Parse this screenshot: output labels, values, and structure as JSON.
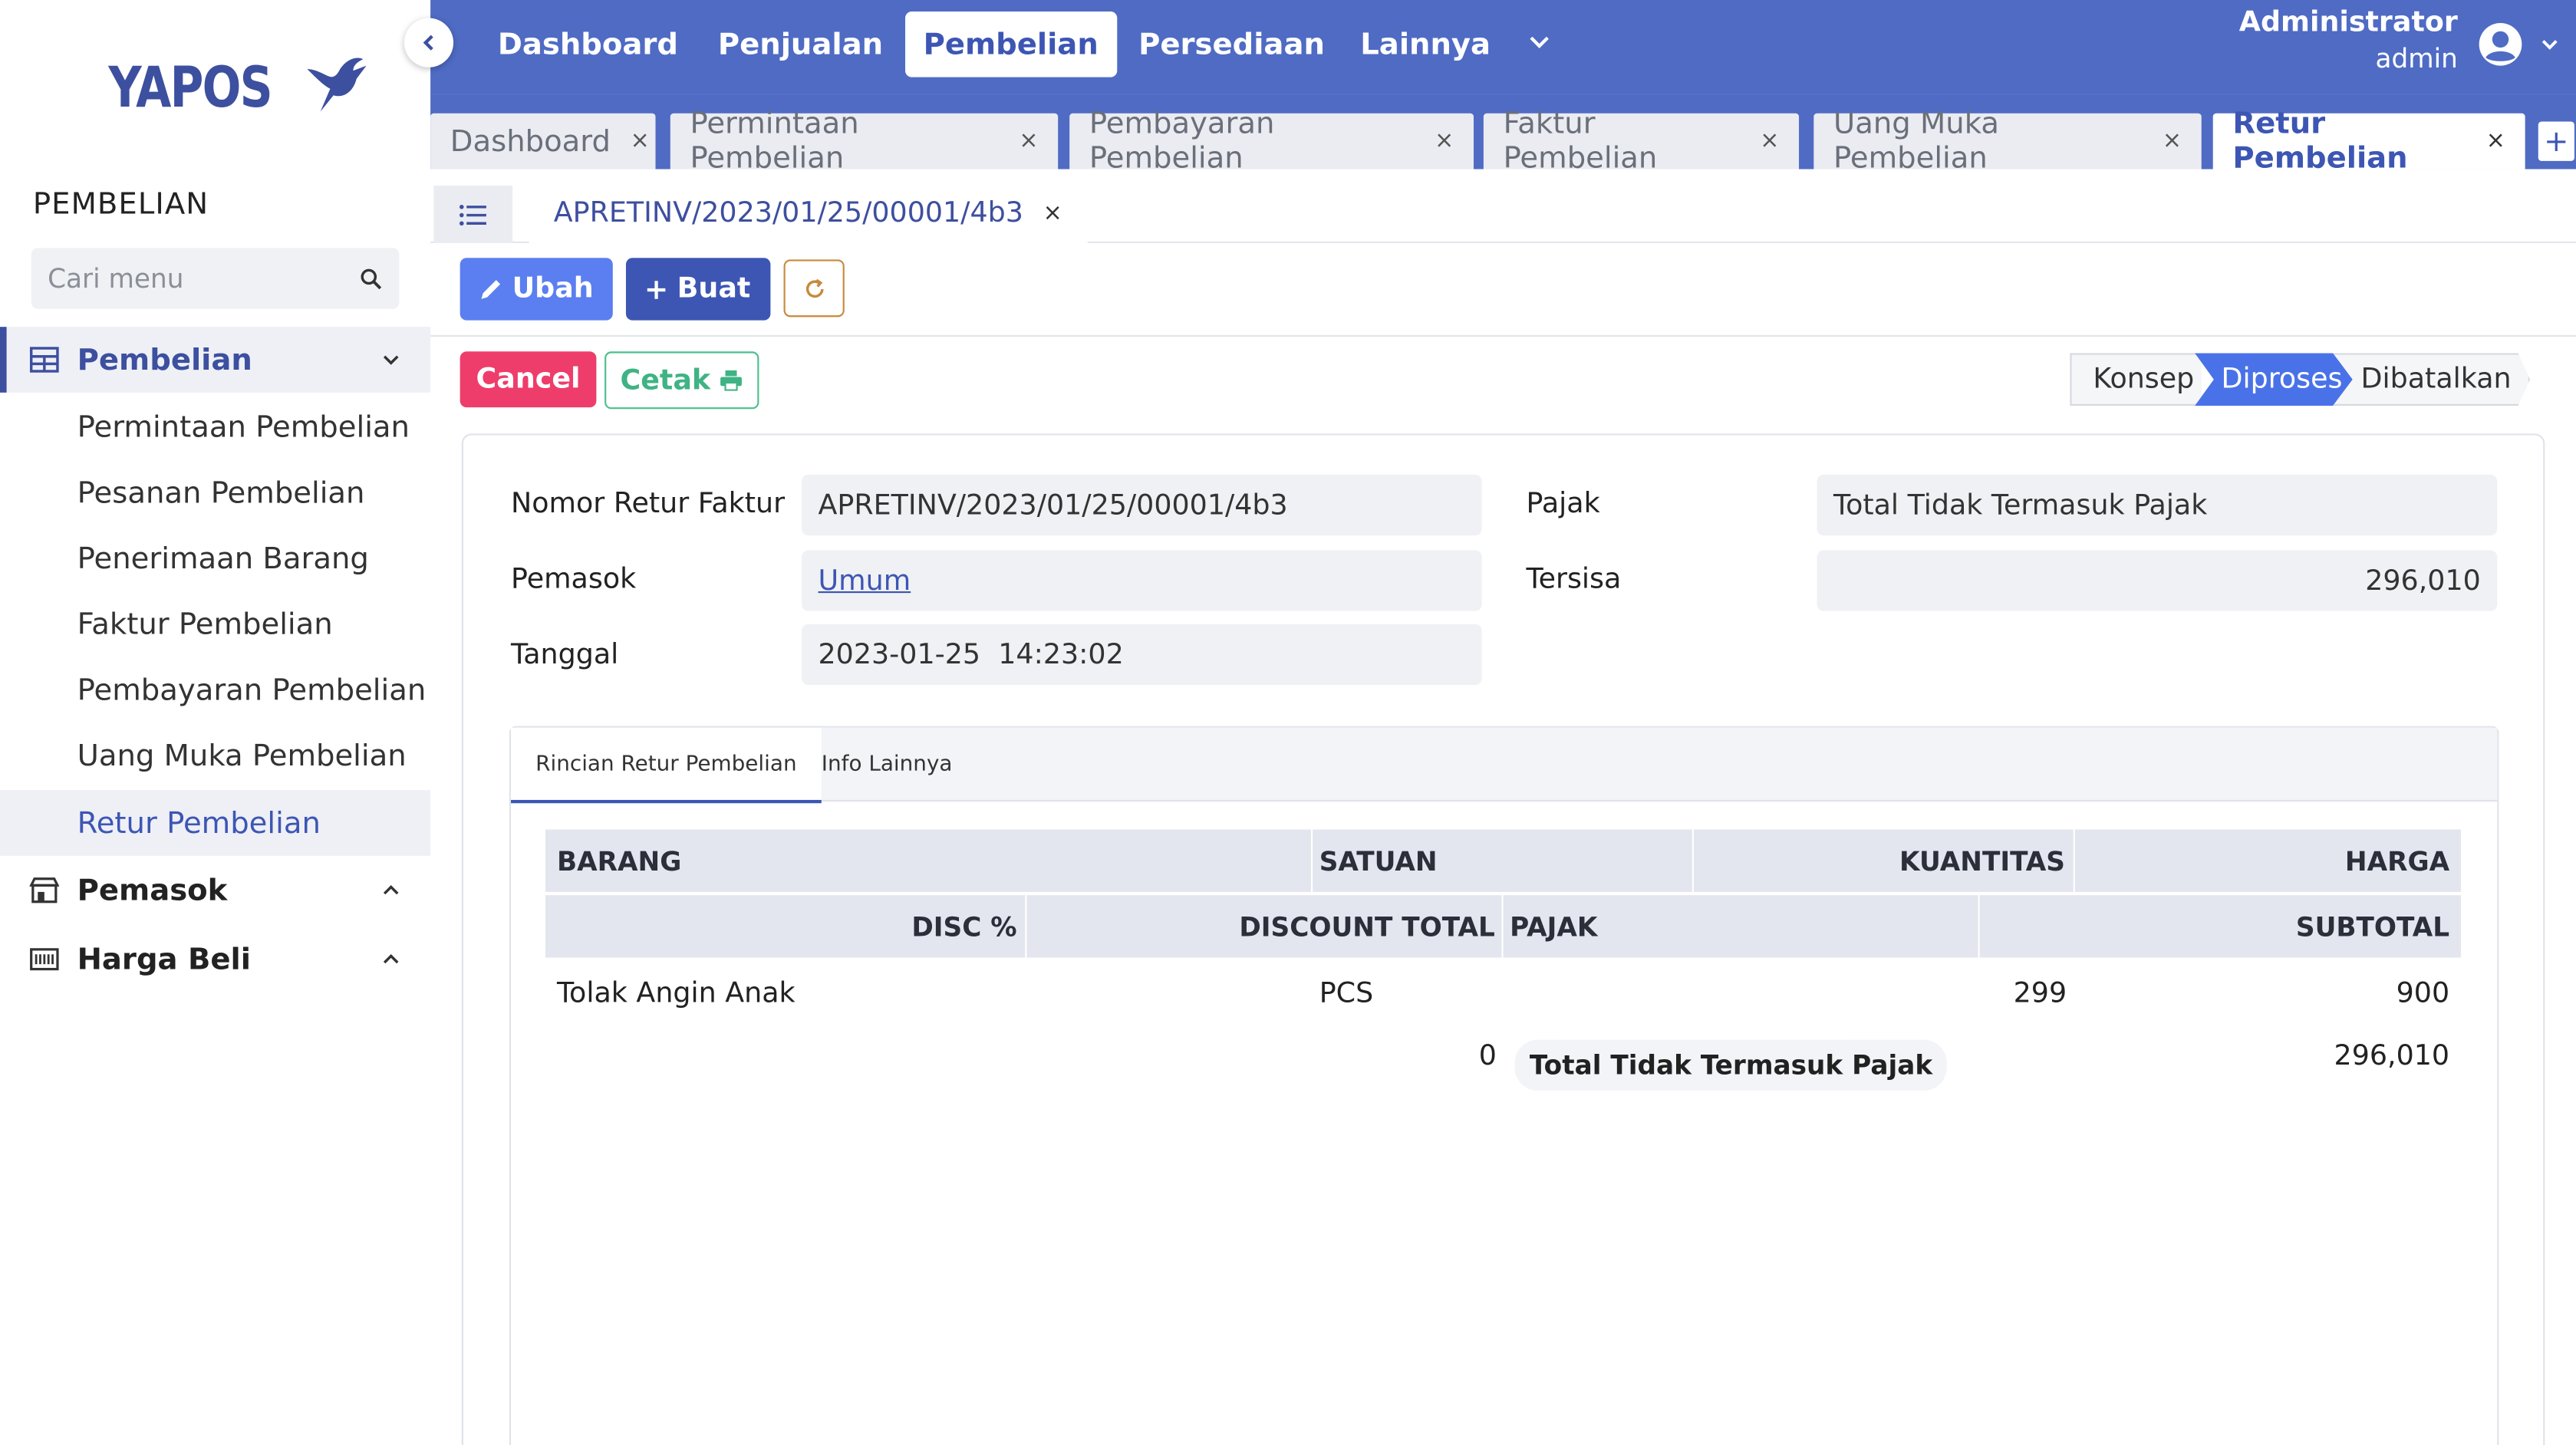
{
  "brand": {
    "logo_text": "YAPOS"
  },
  "sidebar": {
    "section_title": "PEMBELIAN",
    "search_placeholder": "Cari menu",
    "groups": [
      {
        "label": "Pembelian",
        "icon": "table-icon"
      },
      {
        "label": "Pemasok",
        "icon": "store-icon"
      },
      {
        "label": "Harga Beli",
        "icon": "barcode-icon"
      }
    ],
    "items": [
      "Permintaan Pembelian",
      "Pesanan Pembelian",
      "Penerimaan Barang",
      "Faktur Pembelian",
      "Pembayaran Pembelian",
      "Uang Muka Pembelian",
      "Retur Pembelian"
    ]
  },
  "topnav": {
    "items": [
      "Dashboard",
      "Penjualan",
      "Pembelian",
      "Persediaan",
      "Lainnya"
    ],
    "active": "Pembelian",
    "user_name": "Administrator",
    "user_role": "admin"
  },
  "tabs": [
    "Dashboard",
    "Permintaan Pembelian",
    "Pembayaran Pembelian",
    "Faktur Pembelian",
    "Uang Muka Pembelian",
    "Retur Pembelian"
  ],
  "tab_close": "×",
  "tab_add": "+",
  "doc_tab": {
    "label": "APRETINV/2023/01/25/00001/4b3",
    "close": "×"
  },
  "toolbar": {
    "edit_label": "Ubah",
    "create_label": "Buat"
  },
  "actions": {
    "cancel_label": "Cancel",
    "print_label": "Cetak"
  },
  "status_steps": [
    "Konsep",
    "Diproses",
    "Dibatalkan"
  ],
  "status_active": "Diproses",
  "form": {
    "nomor_label": "Nomor Retur Faktur",
    "nomor_value": "APRETINV/2023/01/25/00001/4b3",
    "pemasok_label": "Pemasok",
    "pemasok_value": "Umum",
    "tanggal_label": "Tanggal",
    "tanggal_value": "2023-01-25  14:23:02",
    "pajak_label": "Pajak",
    "pajak_value": "Total Tidak Termasuk Pajak",
    "tersisa_label": "Tersisa",
    "tersisa_value": "296,010"
  },
  "inner_tabs": [
    "Rincian Retur Pembelian",
    "Info Lainnya"
  ],
  "table": {
    "header_row1": [
      "BARANG",
      "SATUAN",
      "KUANTITAS",
      "HARGA"
    ],
    "header_row2": [
      "DISC %",
      "DISCOUNT TOTAL",
      "PAJAK",
      "SUBTOTAL"
    ],
    "rows": [
      {
        "barang": "Tolak Angin Anak",
        "satuan": "PCS",
        "kuantitas": "299",
        "harga": "900",
        "disc": "",
        "discount_total": "0",
        "pajak": "Total Tidak Termasuk Pajak",
        "subtotal": "296,010"
      }
    ]
  },
  "colors": {
    "nav_blue": "#4f6bc4",
    "brand_blue": "#3d4f9f",
    "edit_blue": "#5b7ff0",
    "cancel_red": "#ee3d6b",
    "print_green": "#3fb384",
    "step_active": "#4a72e8"
  }
}
